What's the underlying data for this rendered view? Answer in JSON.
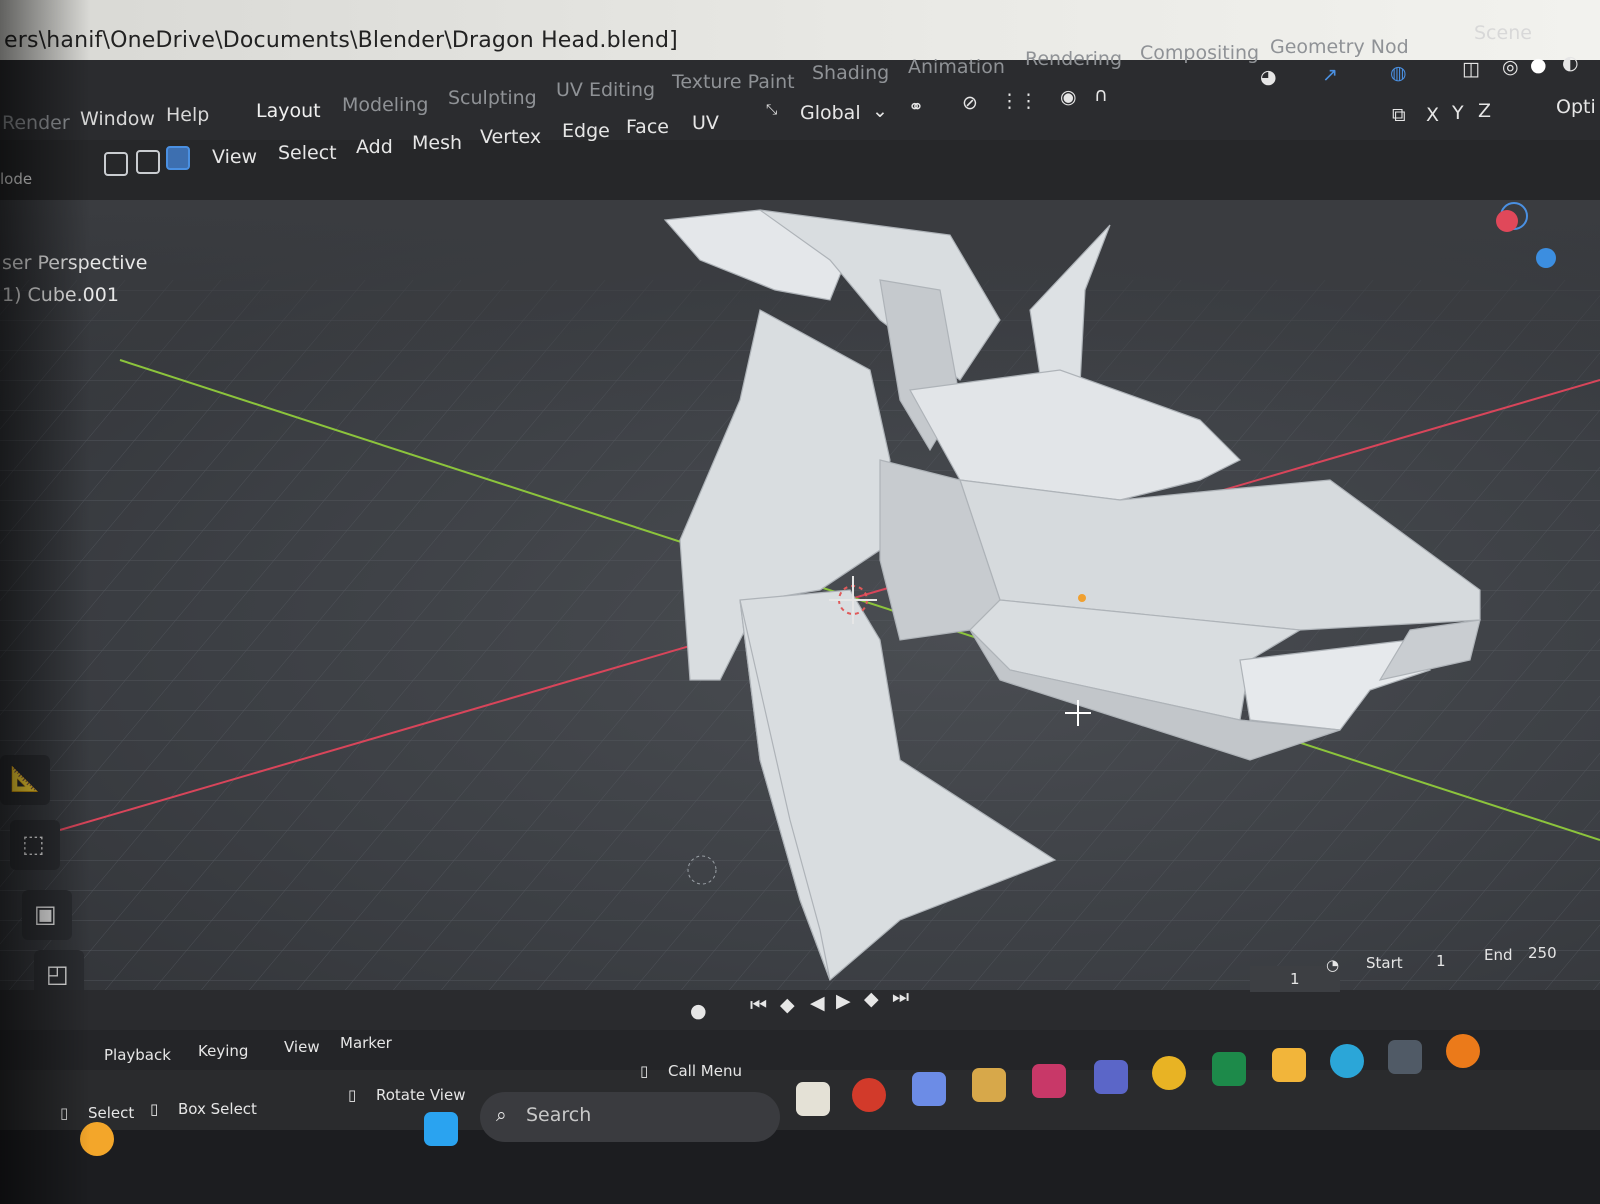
{
  "window": {
    "title_path": "ers\\hanif\\OneDrive\\Documents\\Blender\\Dragon Head.blend]"
  },
  "menubar": {
    "menus": [
      "Render",
      "Window",
      "Help"
    ],
    "workspaces": [
      "Layout",
      "Modeling",
      "Sculpting",
      "UV Editing",
      "Texture Paint",
      "Shading",
      "Animation",
      "Rendering",
      "Compositing",
      "Geometry Nod"
    ],
    "scene_label": "Scene"
  },
  "header": {
    "mode_label": "lode",
    "menus": [
      "View",
      "Select",
      "Add",
      "Mesh",
      "Vertex",
      "Edge",
      "Face",
      "UV"
    ],
    "transform_orientation": "Global",
    "axes": [
      "X",
      "Y",
      "Z"
    ],
    "options_label": "Opti"
  },
  "viewport": {
    "view_name": "ser Perspective",
    "object_name": "1) Cube.001"
  },
  "timeline": {
    "current_frame": "1",
    "start_label": "Start",
    "start_value": "1",
    "end_label": "End",
    "end_value": "250",
    "menus": [
      "Playback",
      "Keying",
      "View",
      "Marker"
    ]
  },
  "statusbar": {
    "select": "Select",
    "box_select": "Box Select",
    "rotate_view": "Rotate View",
    "call_menu": "Call Menu"
  },
  "taskbar": {
    "search_placeholder": "Search"
  },
  "colors": {
    "axis_x": "#e0485a",
    "axis_y": "#8cc43c",
    "axis_z": "#3c8ee0",
    "mesh": "#d9dde0"
  }
}
